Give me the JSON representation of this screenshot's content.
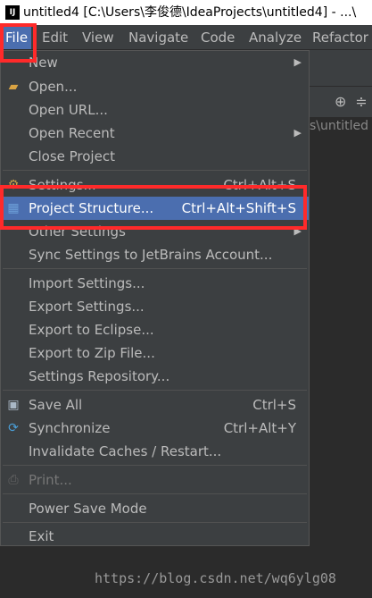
{
  "window": {
    "title": "untitled4 [C:\\Users\\李俊德\\IdeaProjects\\untitled4] - ...\\"
  },
  "menubar": {
    "items": [
      {
        "label": "File",
        "mnemonic": "F"
      },
      {
        "label": "Edit"
      },
      {
        "label": "View"
      },
      {
        "label": "Navigate"
      },
      {
        "label": "Code"
      },
      {
        "label": "Analyze"
      },
      {
        "label": "Refactor"
      }
    ]
  },
  "background": {
    "path_fragment": "s\\untitled"
  },
  "file_menu": {
    "new": "New",
    "open": "Open...",
    "open_url": "Open URL...",
    "open_recent": "Open Recent",
    "close_project": "Close Project",
    "settings": "Settings...",
    "settings_shortcut": "Ctrl+Alt+S",
    "project_structure": "Project Structure...",
    "project_structure_shortcut": "Ctrl+Alt+Shift+S",
    "other_settings": "Other Settings",
    "sync_settings": "Sync Settings to JetBrains Account...",
    "import_settings": "Import Settings...",
    "export_settings": "Export Settings...",
    "export_eclipse": "Export to Eclipse...",
    "export_zip": "Export to Zip File...",
    "settings_repository": "Settings Repository...",
    "save_all": "Save All",
    "save_all_shortcut": "Ctrl+S",
    "synchronize": "Synchronize",
    "synchronize_shortcut": "Ctrl+Alt+Y",
    "invalidate_caches": "Invalidate Caches / Restart...",
    "print": "Print...",
    "power_save_mode": "Power Save Mode",
    "exit": "Exit"
  },
  "watermark": "https://blog.csdn.net/wq6ylg08",
  "colors": {
    "menu_bg": "#3c3f41",
    "highlight": "#4b6eaf",
    "annotation_red": "#ff2a2a"
  }
}
